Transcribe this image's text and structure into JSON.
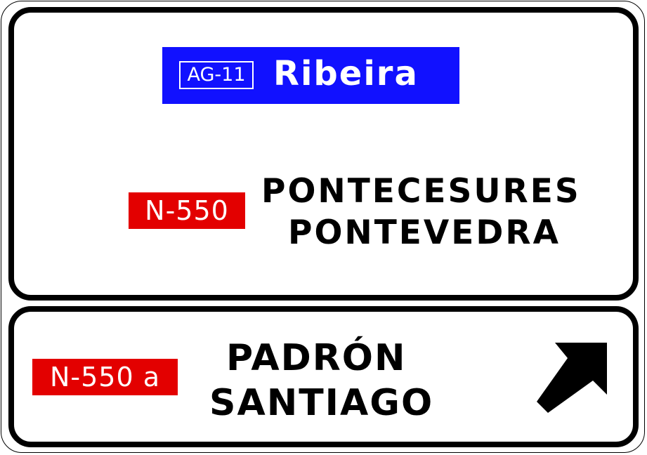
{
  "top_panel": {
    "motorway": {
      "route_code": "AG-11",
      "destination": "Ribeira",
      "color": "#1111ff"
    },
    "national_road": {
      "route_code": "N-550",
      "color": "#e30000",
      "destinations": [
        "PONTECESURES",
        "PONTEVEDRA"
      ]
    }
  },
  "bottom_panel": {
    "route_code": "N-550 a",
    "color": "#e30000",
    "destinations": [
      "PADRÓN",
      "SANTIAGO"
    ],
    "direction_icon": "arrow-up-right-icon"
  }
}
